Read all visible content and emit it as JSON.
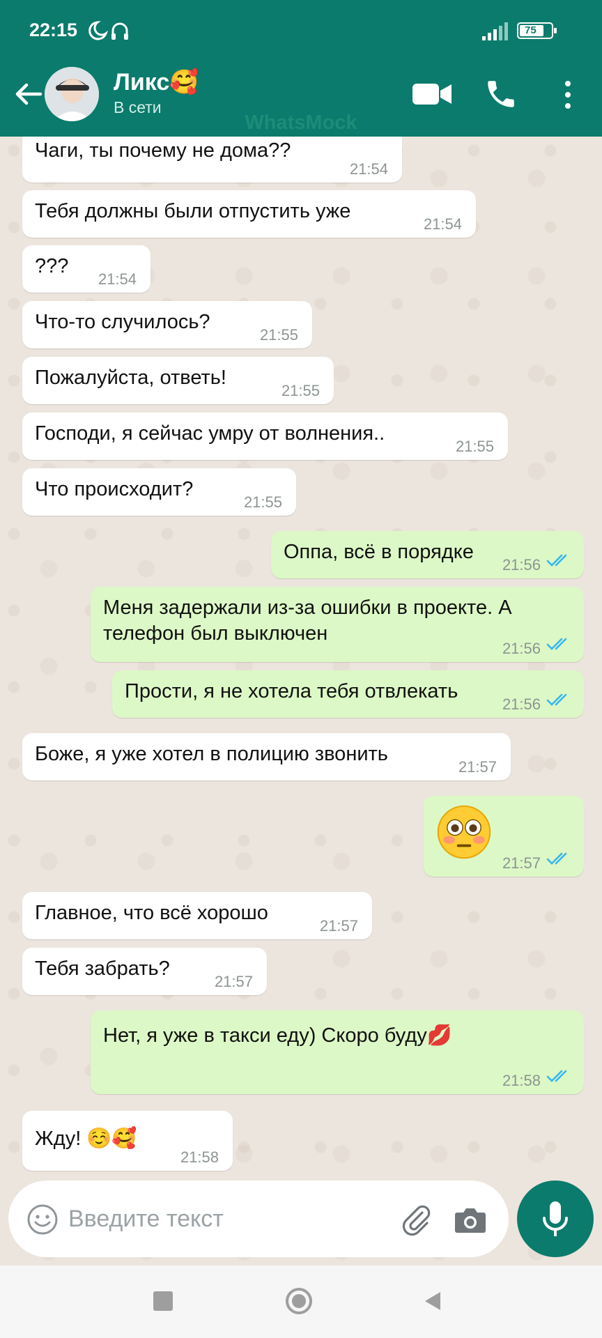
{
  "status_bar": {
    "time": "22:15",
    "battery": "75"
  },
  "header": {
    "contact_name": "Ликс🥰",
    "contact_status": "В сети",
    "watermark": "WhatsMock",
    "icons": [
      "back-arrow-icon",
      "video-call-icon",
      "phone-icon",
      "more-vert-icon"
    ],
    "accent_color": "#0a7b6c"
  },
  "messages": [
    {
      "dir": "in",
      "text": "Чаги, ты почему не дома??",
      "time": "21:54"
    },
    {
      "dir": "in",
      "text": "Тебя должны были отпустить уже",
      "time": "21:54"
    },
    {
      "dir": "in",
      "text": "???",
      "time": "21:54"
    },
    {
      "dir": "in",
      "text": "Что-то случилось?",
      "time": "21:55"
    },
    {
      "dir": "in",
      "text": "Пожалуйста, ответь!",
      "time": "21:55"
    },
    {
      "dir": "in",
      "text": "Господи, я сейчас умру от волнения..",
      "time": "21:55"
    },
    {
      "dir": "in",
      "text": "Что происходит?",
      "time": "21:55"
    },
    {
      "dir": "out",
      "text": "Оппа, всё в порядке",
      "time": "21:56",
      "read": true
    },
    {
      "dir": "out",
      "text": "Меня задержали из-за ошибки в проекте. А\nтелефон был выключен",
      "time": "21:56",
      "read": true
    },
    {
      "dir": "out",
      "text": "Прости, я не хотела тебя отвлекать",
      "time": "21:56",
      "read": true
    },
    {
      "dir": "in",
      "text": "Боже, я уже хотел в полицию звонить",
      "time": "21:57"
    },
    {
      "dir": "out",
      "text": "",
      "emoji": "flushed-face",
      "time": "21:57",
      "read": true
    },
    {
      "dir": "in",
      "text": "Главное, что всё хорошо",
      "time": "21:57"
    },
    {
      "dir": "in",
      "text": "Тебя забрать?",
      "time": "21:57"
    },
    {
      "dir": "out",
      "text": "Нет, я уже в такси еду) Скоро буду💋",
      "time": "21:58",
      "read": true
    },
    {
      "dir": "in",
      "text": "Жду! ☺️🥰",
      "time": "21:58"
    }
  ],
  "composer": {
    "placeholder": "Введите текст",
    "icons": [
      "emoji-icon",
      "attach-icon",
      "camera-icon",
      "mic-icon"
    ]
  },
  "colors": {
    "incoming_bubble": "#ffffff",
    "outgoing_bubble": "#dcf8c6",
    "read_tick": "#34b7f1"
  }
}
